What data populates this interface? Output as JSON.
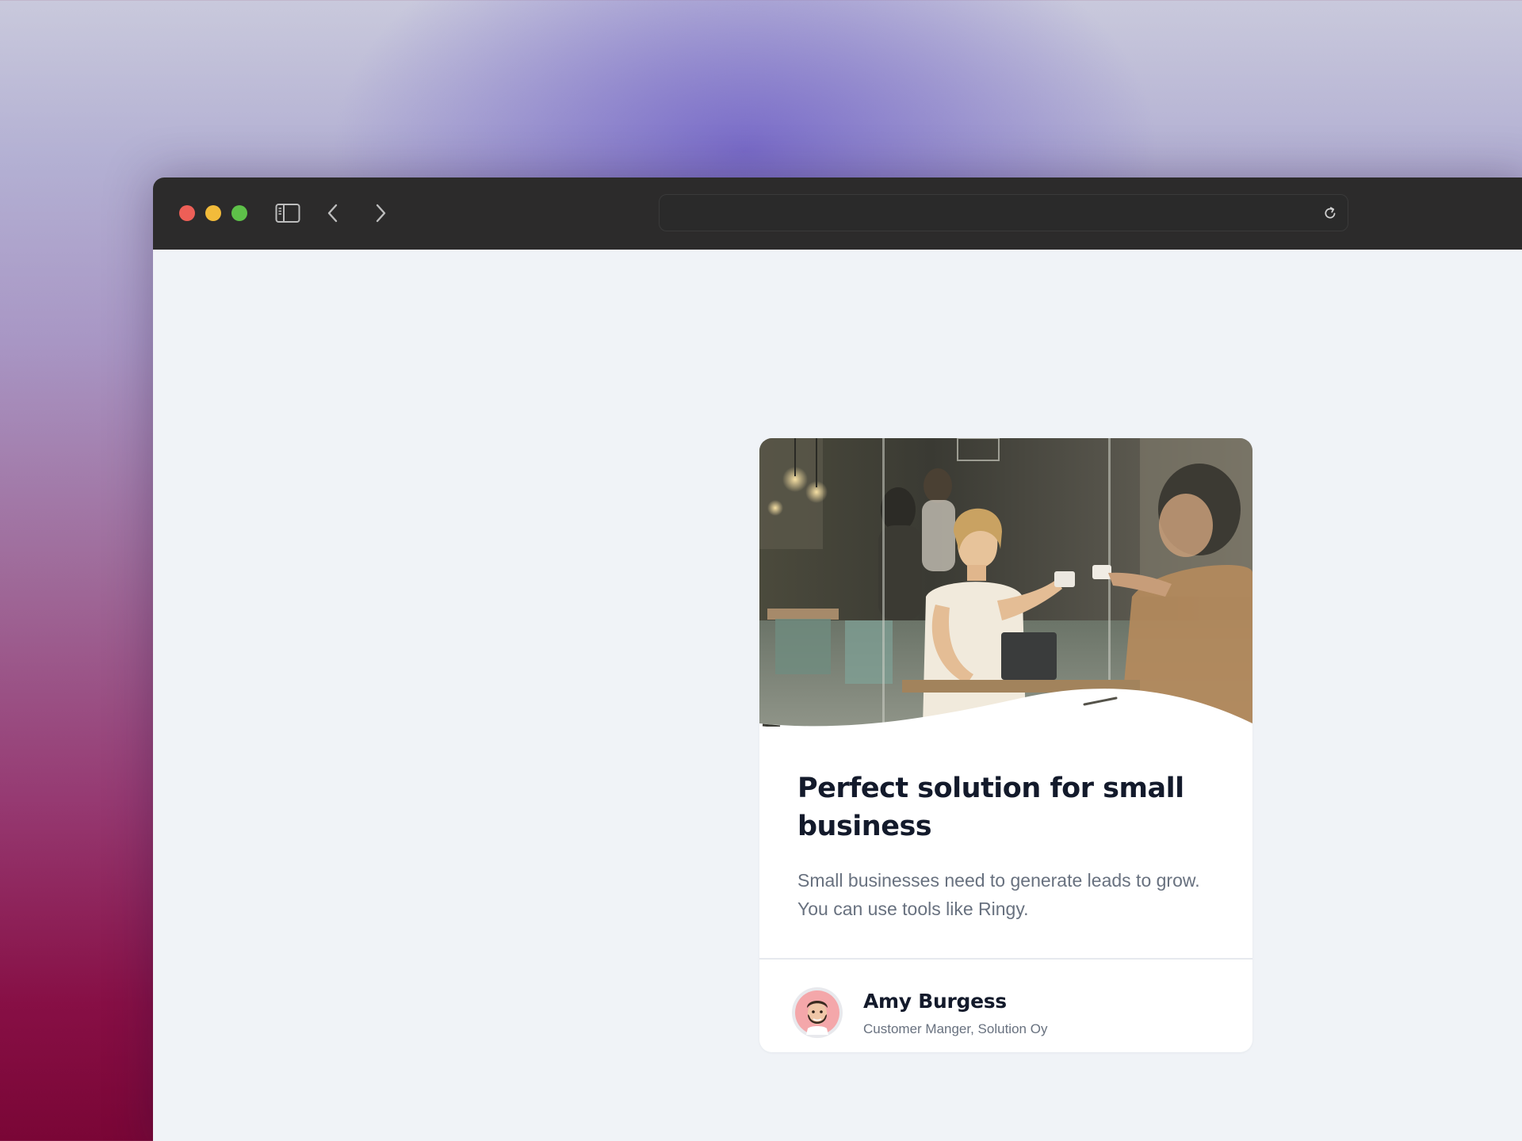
{
  "window": {
    "toolbar": {
      "sidebar_icon": "sidebar-icon",
      "back_icon": "chevron-left-icon",
      "forward_icon": "chevron-right-icon",
      "address_value": "",
      "reload_icon": "reload-icon"
    },
    "traffic_lights": {
      "close_color": "#ed5f57",
      "minimize_color": "#f2bb3a",
      "zoom_color": "#5ec149"
    }
  },
  "card": {
    "image_alt": "",
    "title": "Perfect solution for small business",
    "description": "Small businesses need to generate leads to grow. You can use tools like Ringy.",
    "author": {
      "name": "Amy Burgess",
      "role": "Customer Manger, Solution Oy",
      "avatar_icon": "memoji-avatar-icon"
    }
  },
  "colors": {
    "title": "#131a2b",
    "body_text": "#68717f",
    "page_background": "#f0f3f7",
    "titlebar": "#2c2b2b"
  }
}
